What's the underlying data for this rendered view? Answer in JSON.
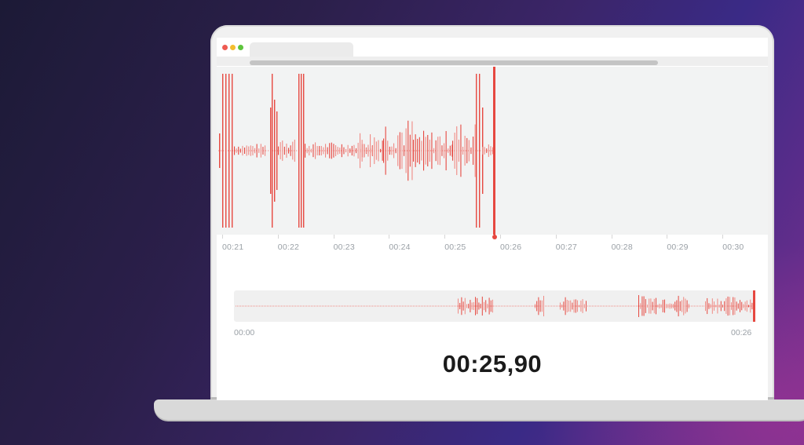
{
  "timeline": {
    "labels": [
      "00:21",
      "00:22",
      "00:23",
      "00:24",
      "00:25",
      "00:26",
      "00:27",
      "00:28",
      "00:29",
      "00:30"
    ]
  },
  "overview": {
    "start_label": "00:00",
    "end_label": "00:26"
  },
  "current_time": "00:25,90",
  "colors": {
    "waveform": "#e64840",
    "waveform_light": "#f08a84",
    "panel_bg": "#f2f3f3",
    "traffic_red": "#ee5b52",
    "traffic_yellow": "#f3bd2f",
    "traffic_green": "#5dc43c"
  }
}
